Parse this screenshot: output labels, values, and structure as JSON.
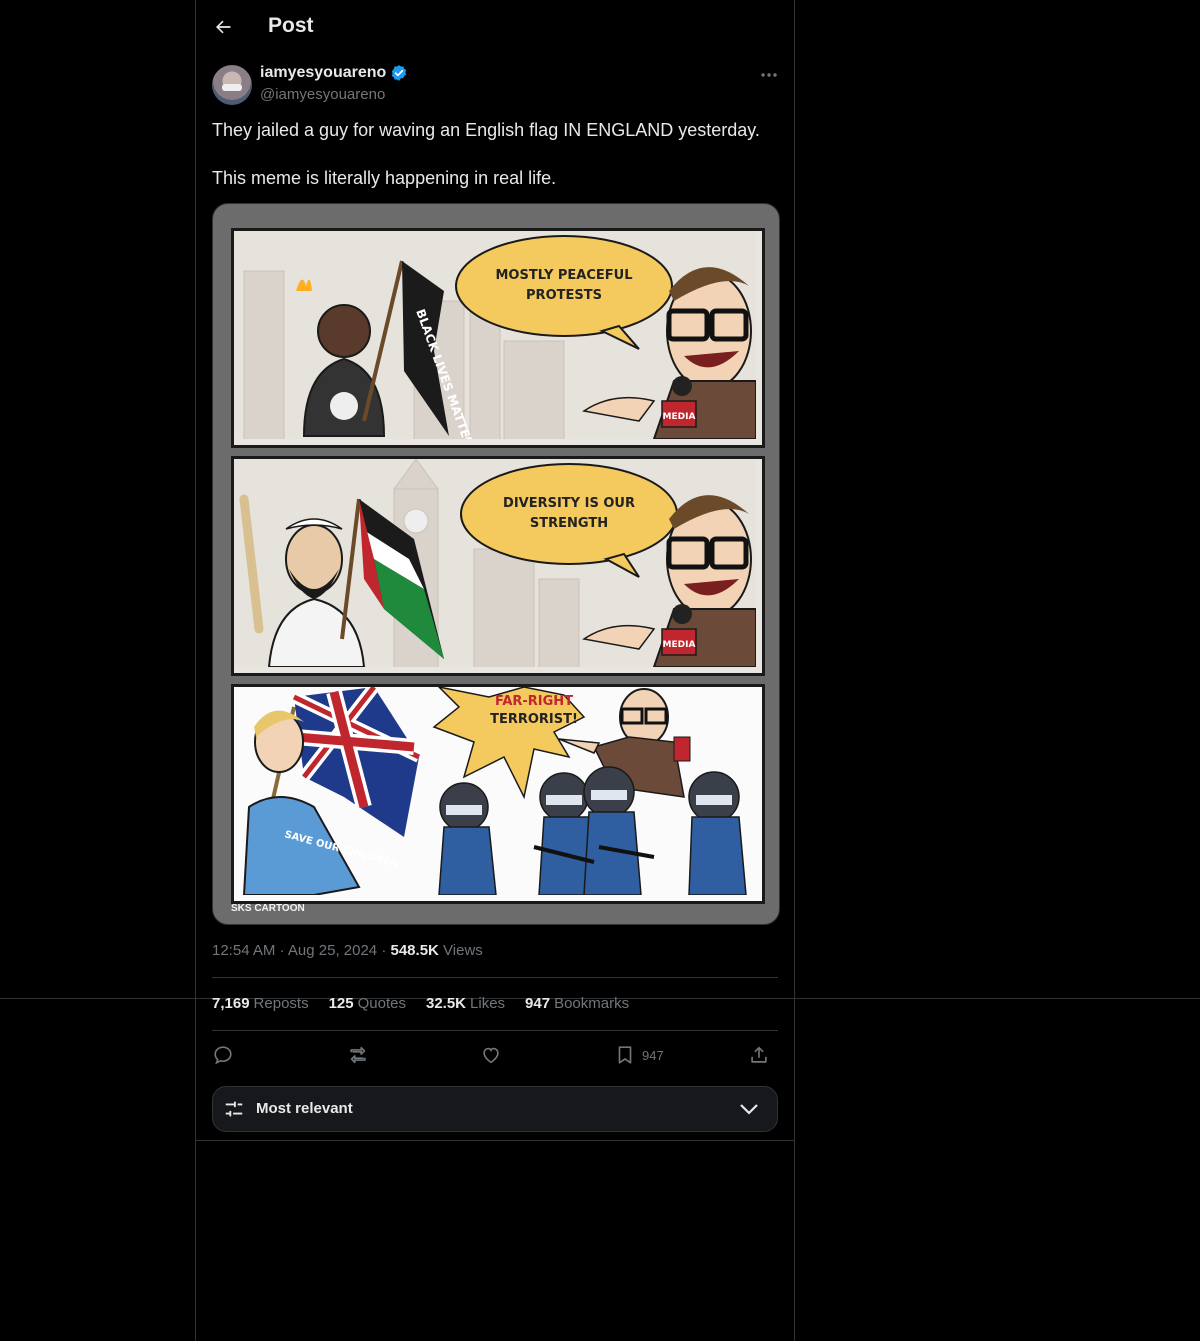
{
  "header": {
    "title": "Post"
  },
  "author": {
    "display_name": "iamyesyouareno",
    "handle": "@iamyesyouareno"
  },
  "tweet": {
    "paragraphs": [
      "They jailed a guy for waving an English flag IN ENGLAND yesterday.",
      "This meme is literally happening in real life."
    ]
  },
  "media": {
    "panel1": {
      "bubble_line1": "MOSTLY PEACEFUL",
      "bubble_line2": "PROTESTS",
      "flag_text": "BLACK LIVES MATTER",
      "mic_label": "MEDIA"
    },
    "panel2": {
      "bubble_line1": "DIVERSITY IS OUR",
      "bubble_line2": "STRENGTH",
      "mic_label": "MEDIA"
    },
    "panel3": {
      "bubble_line1": "FAR-RIGHT",
      "bubble_line2": "TERRORIST!",
      "shirt_text": "SAVE OUR CHILDREN"
    },
    "credit": "SKS CARTOON"
  },
  "meta": {
    "time": "12:54 AM",
    "date": "Aug 25, 2024",
    "views_count": "548.5K",
    "views_label": "Views",
    "separator": "·"
  },
  "stats": {
    "reposts_count": "7,169",
    "reposts_label": "Reposts",
    "quotes_count": "125",
    "quotes_label": "Quotes",
    "likes_count": "32.5K",
    "likes_label": "Likes",
    "bookmarks_count": "947",
    "bookmarks_label": "Bookmarks"
  },
  "actions": {
    "bookmark_count": "947"
  },
  "sort": {
    "label": "Most relevant"
  },
  "colors": {
    "background": "#000000",
    "text": "#e7e9ea",
    "muted": "#71767b",
    "border": "#2f3336",
    "verified": "#1d9bf0"
  },
  "icons": [
    "back-arrow-icon",
    "verified-badge-icon",
    "more-icon",
    "reply-icon",
    "repost-icon",
    "like-icon",
    "bookmark-icon",
    "share-icon",
    "sliders-icon",
    "chevron-down-icon"
  ]
}
